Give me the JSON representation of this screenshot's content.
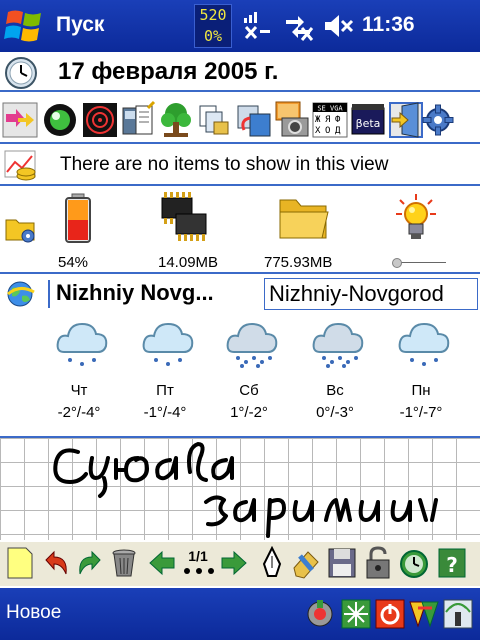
{
  "taskbar": {
    "start_label": "Пуск",
    "counter_top": "520",
    "counter_bottom": "0%",
    "clock": "11:36"
  },
  "date": {
    "text": "17 февраля 2005 г."
  },
  "apps": {
    "icons": [
      "explorer-icon",
      "contacts-icon",
      "radar-icon",
      "notes-icon",
      "tree-icon",
      "files-icon",
      "transfer-icon",
      "camera-icon",
      "se-vga-icon",
      "beta-icon",
      "door-icon",
      "gear-icon"
    ],
    "se_vga_label": "SE VGA",
    "beta_label": "βeta"
  },
  "tasks": {
    "message": "There are no items to show in this view"
  },
  "status": {
    "battery_label": "54%",
    "memory_label": "14.09MB",
    "storage_label": "775.93MB",
    "brightness_level": 0
  },
  "weather": {
    "city": "Nizhniy Novg...",
    "location": "Nizhniy-Novgorod",
    "forecast": [
      {
        "day": "Чт",
        "temp": "-2°/-4°",
        "icon": "snow-cloud-icon"
      },
      {
        "day": "Пт",
        "temp": "-1°/-4°",
        "icon": "snow-cloud-icon"
      },
      {
        "day": "Сб",
        "temp": "1°/-2°",
        "icon": "heavy-snow-cloud-icon"
      },
      {
        "day": "Вс",
        "temp": "0°/-3°",
        "icon": "heavy-snow-cloud-icon"
      },
      {
        "day": "Пн",
        "temp": "-1°/-7°",
        "icon": "snow-cloud-icon"
      }
    ]
  },
  "notes": {
    "page_indicator": "1/1"
  },
  "bottombar": {
    "new_label": "Новое"
  },
  "colors": {
    "accent_bar": "#0c2a9a",
    "separator": "#3b6ac8",
    "counter_text": "#f0e640"
  }
}
